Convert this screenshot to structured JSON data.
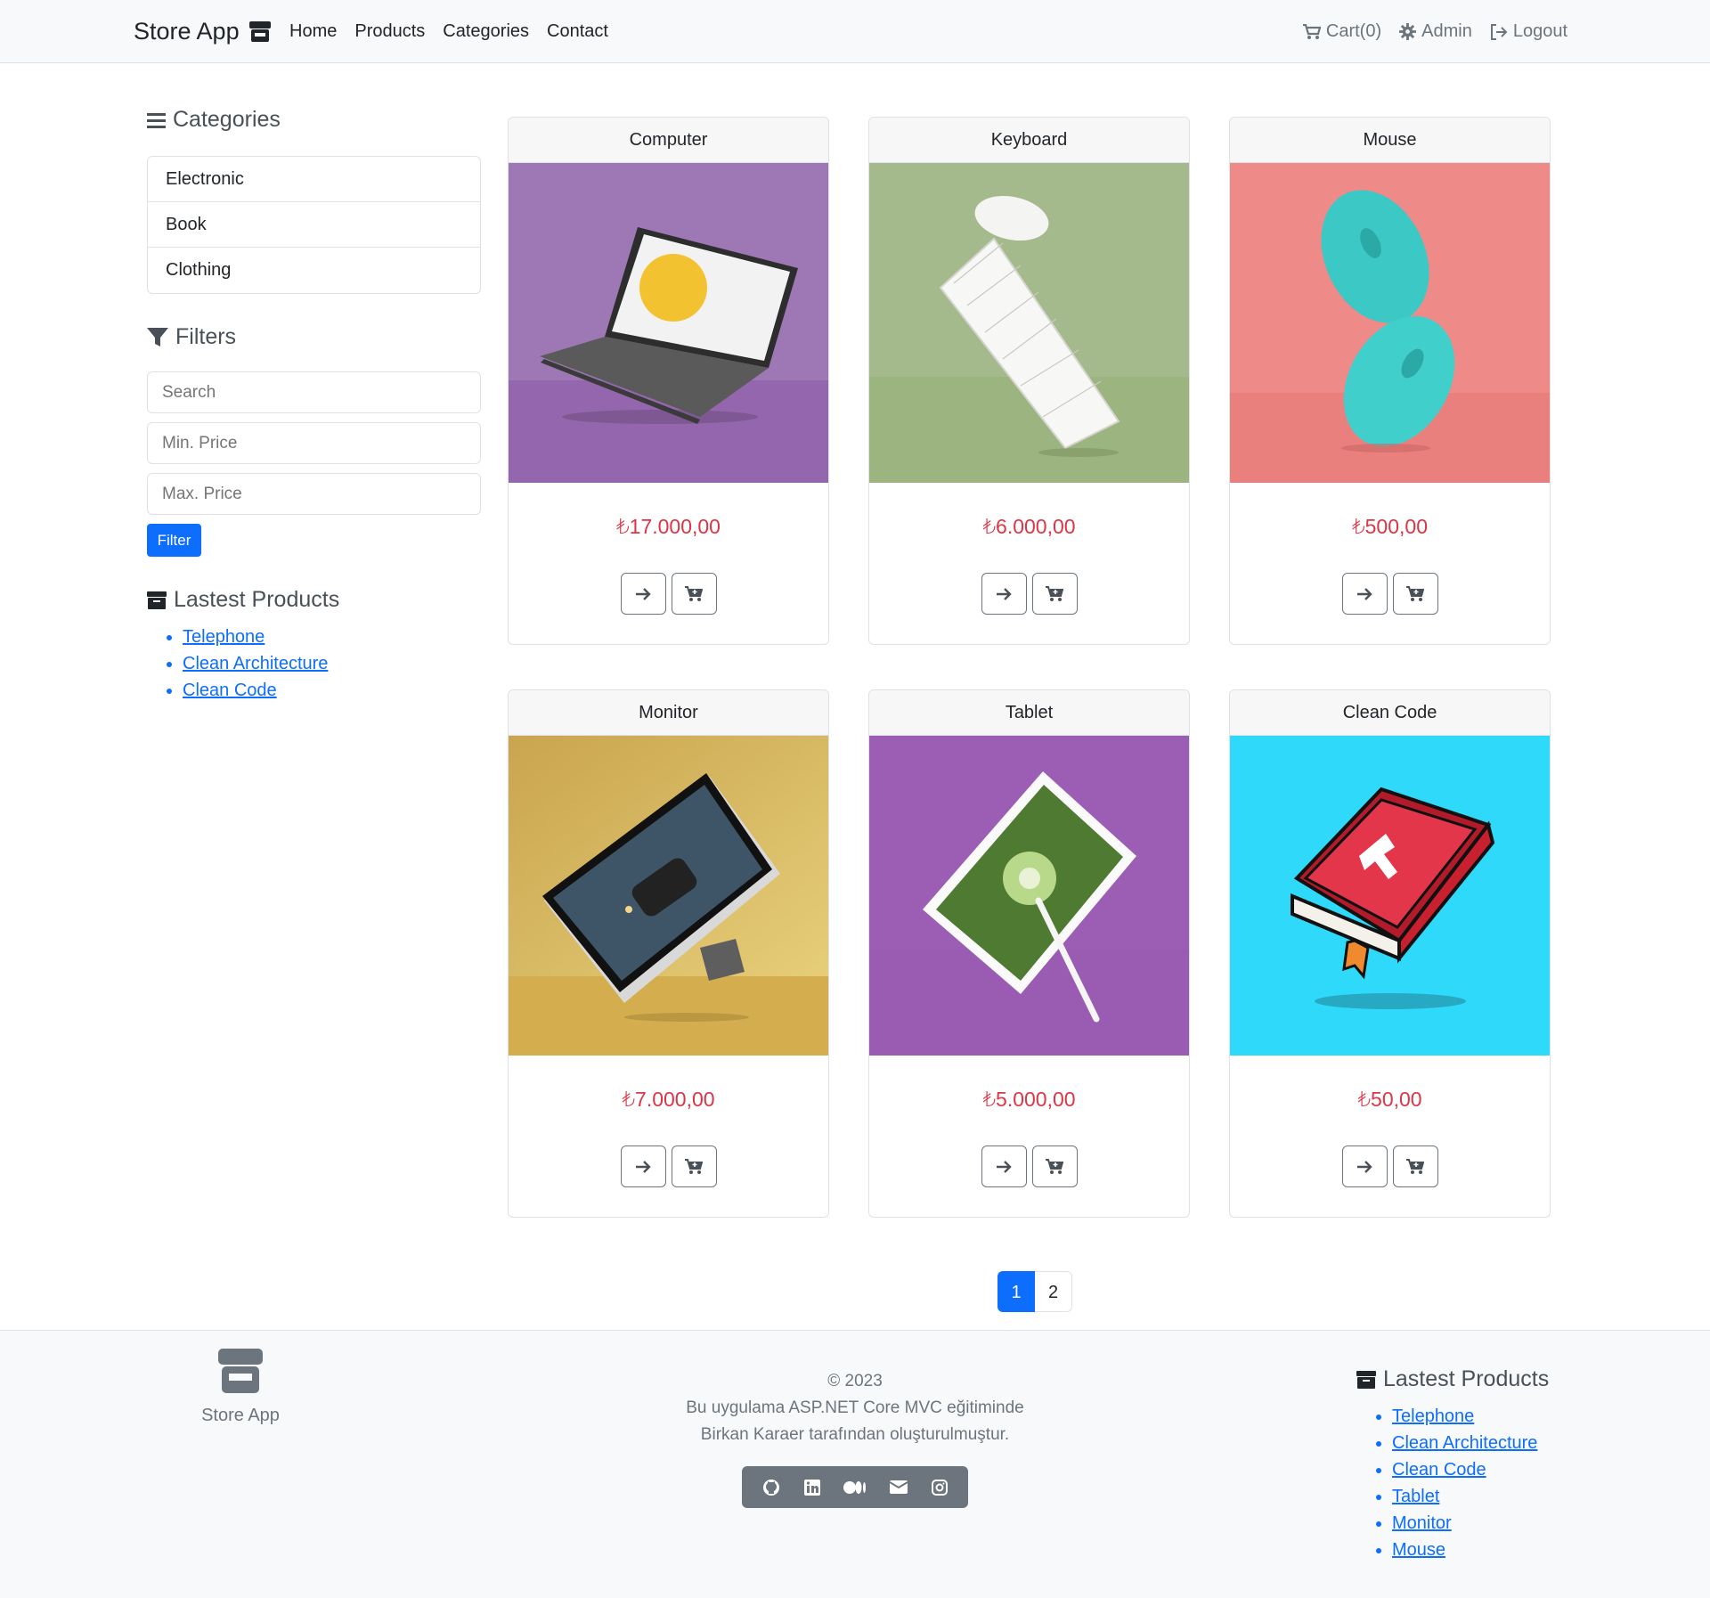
{
  "nav": {
    "brand": "Store App",
    "links": [
      "Home",
      "Products",
      "Categories",
      "Contact"
    ],
    "cart": "Cart(0)",
    "admin": "Admin",
    "logout": "Logout"
  },
  "sidebar": {
    "categories_title": "Categories",
    "categories": [
      "Electronic",
      "Book",
      "Clothing"
    ],
    "filters_title": "Filters",
    "search_placeholder": "Search",
    "min_price_placeholder": "Min. Price",
    "max_price_placeholder": "Max. Price",
    "filter_button": "Filter",
    "latest_title": "Lastest Products",
    "latest": [
      "Telephone",
      "Clean Architecture",
      "Clean Code"
    ]
  },
  "products": [
    {
      "name": "Computer",
      "price": "₺17.000,00",
      "bg": "#9d78b4",
      "floor": "#9466ad"
    },
    {
      "name": "Keyboard",
      "price": "₺6.000,00",
      "bg": "#a4b98c",
      "floor": "#9cb47f"
    },
    {
      "name": "Mouse",
      "price": "₺500,00",
      "bg": "#ee8a88",
      "floor": "#ea807e"
    },
    {
      "name": "Monitor",
      "price": "₺7.000,00",
      "bg": "#dcba5f",
      "floor": "#d4ae4e"
    },
    {
      "name": "Tablet",
      "price": "₺5.000,00",
      "bg": "#9c5eb4",
      "floor": "#9a5cb3"
    },
    {
      "name": "Clean Code",
      "price": "₺50,00",
      "bg": "#2fd9f9",
      "floor": "#2fd9f9"
    }
  ],
  "pagination": [
    "1",
    "2"
  ],
  "footer": {
    "brand": "Store App",
    "copyright": "© 2023",
    "line1": "Bu uygulama ASP.NET Core MVC eğitiminde",
    "line2": "Birkan Karaer tarafından oluşturulmuştur.",
    "latest_title": "Lastest Products",
    "latest": [
      "Telephone",
      "Clean Architecture",
      "Clean Code",
      "Tablet",
      "Monitor",
      "Mouse"
    ]
  },
  "colors": {
    "primary": "#0d6efd",
    "price": "#dc3545"
  }
}
